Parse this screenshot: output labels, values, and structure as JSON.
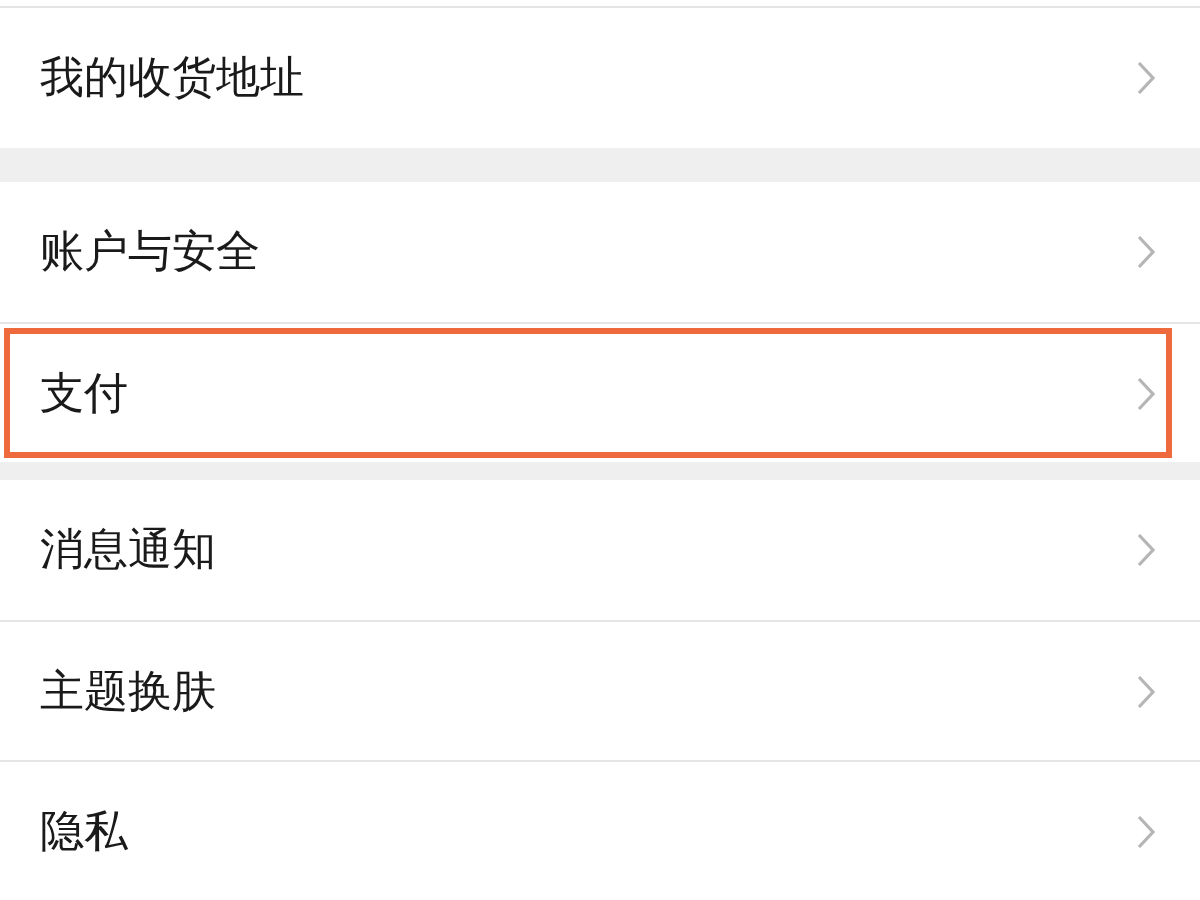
{
  "groups": [
    {
      "items": [
        {
          "label": "我的收货地址",
          "highlighted": false
        }
      ]
    },
    {
      "items": [
        {
          "label": "账户与安全",
          "highlighted": false
        },
        {
          "label": "支付",
          "highlighted": true
        }
      ]
    },
    {
      "items": [
        {
          "label": "消息通知",
          "highlighted": false
        },
        {
          "label": "主题换肤",
          "highlighted": false
        },
        {
          "label": "隐私",
          "highlighted": false
        }
      ]
    }
  ]
}
